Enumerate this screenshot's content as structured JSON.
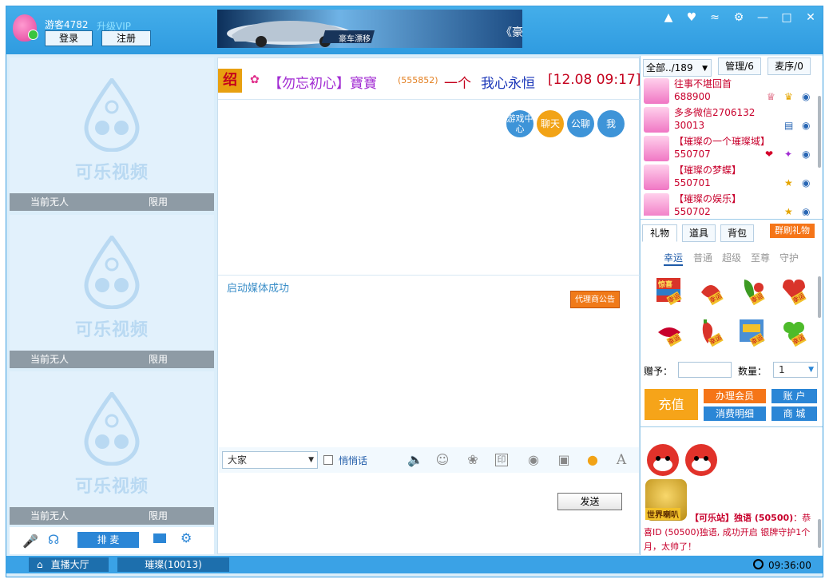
{
  "titlebar": {
    "username": "游客4782",
    "vip_link": "升级VIP",
    "login_label": "登录",
    "register_label": "注册",
    "banner_text": "《豪",
    "banner_sign": "豪车漂移"
  },
  "video_slots": [
    {
      "status": "当前无人",
      "limit": "限用",
      "watermark": "可乐视频"
    },
    {
      "status": "当前无人",
      "limit": "限用",
      "watermark": "可乐视频"
    },
    {
      "status": "当前无人",
      "limit": "限用",
      "watermark": "可乐视频"
    }
  ],
  "left_toolbar": {
    "queue_label": "排 麦"
  },
  "chat": {
    "ticker_badge": "绍",
    "ticker_name": "【勿忘初心】寶寶",
    "ticker_id": "(555852)",
    "ticker_msg1": "一个",
    "ticker_msg2": "我心永恒",
    "ticker_time": "[12.08 09:17]",
    "mode_buttons": [
      "游戏中心",
      "聊天",
      "公聊",
      "我"
    ],
    "system_msg": "启动媒体成功",
    "agent_notice": "代理商公告",
    "target_select": "大家",
    "whisper_label": "悄悄话",
    "send_label": "发送"
  },
  "userlist": {
    "tabs": [
      "全部../189",
      "管理/6",
      "麦序/0"
    ],
    "users": [
      {
        "name": "往事不堪回首",
        "id": "688900",
        "name_color": "#c8002c"
      },
      {
        "name": "多多微信2706132",
        "id": "30013",
        "name_color": "#c8002c"
      },
      {
        "name": "【璀璨の一个璀璨域】",
        "id": "550707",
        "name_color": "#c8002c"
      },
      {
        "name": "【璀璨の梦蝶】",
        "id": "550701",
        "name_color": "#c8002c"
      },
      {
        "name": "【璀璨の娱乐】",
        "id": "550702",
        "name_color": "#c8002c"
      }
    ]
  },
  "gifts": {
    "tabs": [
      "礼物",
      "道具",
      "背包"
    ],
    "group_gift": "群刷礼物",
    "categories": [
      "幸运",
      "普通",
      "超级",
      "至尊",
      "守护"
    ],
    "give_to_label": "赠予：",
    "quantity_label": "数量：",
    "quantity_value": "1",
    "recharge_label": "充值",
    "member_label": "办理会员",
    "account_label": "账 户",
    "spending_label": "消费明细",
    "shop_label": "商 城",
    "gift_tag": "幸运",
    "gift_sign": "惊喜"
  },
  "broadcast": {
    "badge": "世界喇叭",
    "sender": "【可乐站】独语 (50500)",
    "message": "：恭喜ID (50500)独语, 成功开启 银牌守护1个月，太帅了！"
  },
  "statusbar": {
    "hall_label": "直播大厅",
    "room_label": "璀璨(10013)",
    "clock": "09:36:00"
  },
  "colors": {
    "accent": "#3aa2e6",
    "recharge": "#f6a419",
    "orange": "#f57518"
  }
}
